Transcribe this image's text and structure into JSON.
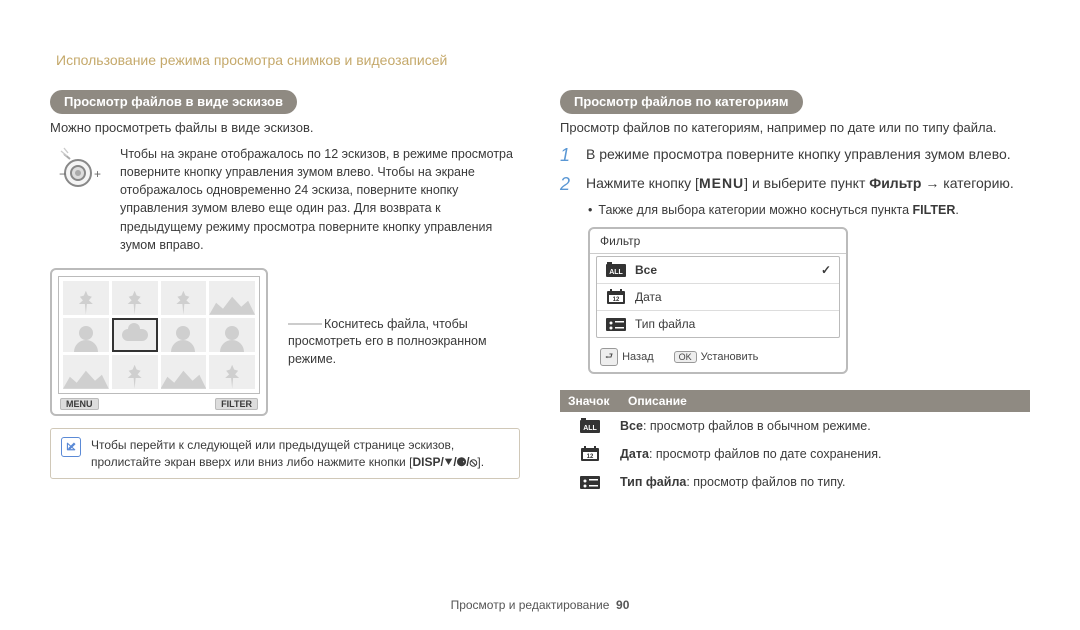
{
  "header": "Использование режима просмотра снимков и видеозаписей",
  "left": {
    "pill": "Просмотр файлов в виде эскизов",
    "intro": "Можно просмотреть файлы в виде эскизов.",
    "dial_text": "Чтобы на экране отображалось по 12 эскизов, в режиме просмотра поверните кнопку управления зумом влево. Чтобы на экране отображалось одновременно 24 эскиза, поверните кнопку управления зумом влево еще один раз. Для возврата к предыдущему режиму просмотра поверните кнопку управления зумом вправо.",
    "thumb_menu": "MENU",
    "thumb_filter": "FILTER",
    "thumb_caption": "Коснитесь файла, чтобы просмотреть его в полноэкранном режиме.",
    "note": "Чтобы перейти к следующей или предыдущей странице эскизов, пролистайте экран вверх или вниз либо нажмите кнопки [",
    "note_keys": "DISP/⯆/⚈/⦸",
    "note_end": "]."
  },
  "right": {
    "pill": "Просмотр файлов по категориям",
    "intro": "Просмотр файлов по категориям, например по дате или по типу файла.",
    "step1": "В режиме просмотра поверните кнопку управления зумом влево.",
    "step2_a": "Нажмите кнопку [",
    "step2_menu": "MENU",
    "step2_b": "] и выберите пункт ",
    "step2_bold": "Фильтр",
    "step2_c": " → категорию.",
    "bullet": "Также для выбора категории можно коснуться пункта ",
    "bullet_bold": "FILTER",
    "bullet_end": ".",
    "filter": {
      "title": "Фильтр",
      "item_all": "Все",
      "item_date": "Дата",
      "item_type": "Тип файла",
      "back": "Назад",
      "ok": "Установить"
    },
    "table": {
      "h1": "Значок",
      "h2": "Описание",
      "r1b": "Все",
      "r1": ": просмотр файлов в обычном режиме.",
      "r2b": "Дата",
      "r2": ": просмотр файлов по дате сохранения.",
      "r3b": "Тип файла",
      "r3": ": просмотр файлов по типу."
    }
  },
  "footer": {
    "section": "Просмотр и редактирование",
    "page": "90"
  }
}
